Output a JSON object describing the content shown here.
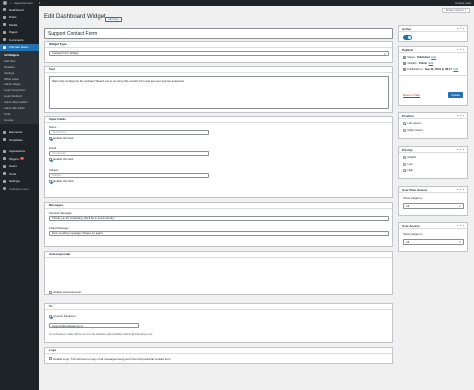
{
  "admin_bar": {
    "site": "mayorpor.com",
    "count": "1",
    "greeting": "Howdy, jaoli"
  },
  "screen_options": "Screen Options",
  "sidebar": {
    "items_top": [
      {
        "label": "Dashboard",
        "icon": "dashboard-icon"
      },
      {
        "label": "Posts",
        "icon": "pin-icon"
      },
      {
        "label": "Media",
        "icon": "media-icon"
      },
      {
        "label": "Pages",
        "icon": "page-icon"
      },
      {
        "label": "Comments",
        "icon": "comment-icon"
      }
    ],
    "active": {
      "label": "Ultimate Dash...",
      "icon": "dashboard-widget-icon"
    },
    "submenu": [
      "All Widgets",
      "Add New",
      "Modules",
      "Settings",
      "White Label",
      "Admin Pages",
      "Login Customizer",
      "Login Redirect",
      "Admin Menu Editor",
      "Admin Bar Editor",
      "Tools",
      "License"
    ],
    "items_bottom": [
      {
        "label": "Elementor",
        "icon": "elementor-icon"
      },
      {
        "label": "Templates",
        "icon": "templates-icon"
      },
      {
        "label": "Appearance",
        "icon": "brush-icon"
      },
      {
        "label": "Plugins",
        "icon": "plug-icon",
        "badge": "6"
      },
      {
        "label": "Users",
        "icon": "users-icon"
      },
      {
        "label": "Tools",
        "icon": "wrench-icon"
      },
      {
        "label": "Settings",
        "icon": "settings-icon"
      },
      {
        "label": "Collapse menu",
        "icon": "collapse-icon"
      }
    ]
  },
  "page": {
    "title": "Edit Dashboard Widget",
    "add_new": "Add New",
    "widget_title": "Support Contact Form"
  },
  "widget_type": {
    "heading": "Widget Type",
    "value": "Contact Form Widget"
  },
  "text_box": {
    "heading": "Text",
    "value": "Want help configuring the website? Reach out to us using this contact form and get your queries answered."
  },
  "input_fields": {
    "heading": "Input Fields",
    "name_label": "Name",
    "name_placeholder": "Your Name",
    "name_enable": "Enable this field",
    "email_label": "Email",
    "email_placeholder": "Your Email",
    "email_enable": "Enable this field",
    "subject_label": "Subject",
    "subject_placeholder": "Subject",
    "subject_enable": "Enable this field"
  },
  "messages": {
    "heading": "Messages",
    "success_label": "Success Message",
    "success_value": "Thank you for contacting. We'll be in touch shortly!",
    "failed_label": "Failed Message",
    "failed_value": "Error sending message. Please try again."
  },
  "autoresponder": {
    "heading": "Autoresponder",
    "enable": "Enable Autoresponder"
  },
  "to": {
    "heading": "To",
    "custom": "Custom Recipient",
    "email": "support@smartagency.io",
    "description": "If unchecked, mails will be sent to the website administrator (admin@example.com)."
  },
  "logs": {
    "heading": "Logs",
    "enable": "Enable Logs. This will store a copy of all messages being sent from this particular contact form."
  },
  "active_box": {
    "heading": "Active"
  },
  "publish_box": {
    "heading": "Publish",
    "status_label": "Status:",
    "status_value": "Published",
    "status_edit": "Edit",
    "visibility_label": "Visibility:",
    "visibility_value": "Public",
    "visibility_edit": "Edit",
    "published_label": "Published on:",
    "published_value": "Sep 22, 2021 @ 08:17",
    "published_edit": "Edit",
    "trash": "Move to Trash",
    "update": "Update"
  },
  "position_box": {
    "heading": "Position",
    "options": [
      "Left column",
      "Right column"
    ]
  },
  "priority_box": {
    "heading": "Priority",
    "options": [
      "Default",
      "Low",
      "High"
    ]
  },
  "user_role_box": {
    "heading": "User Role Access",
    "label": "Show widget to:",
    "value": "All"
  },
  "user_access_box": {
    "heading": "User Access",
    "label": "Show widget to:",
    "value": "All"
  }
}
